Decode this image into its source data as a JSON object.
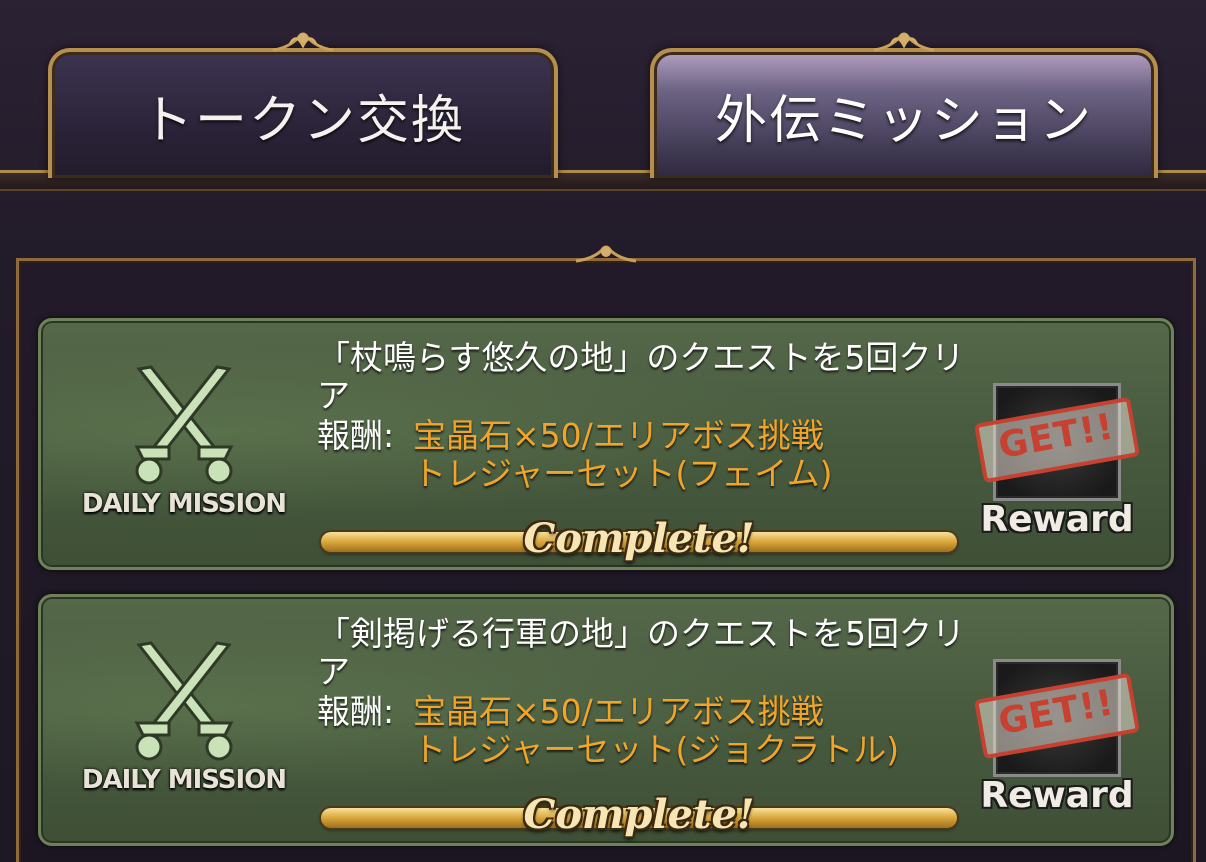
{
  "tabs": [
    {
      "label": "トークン交換",
      "active": false
    },
    {
      "label": "外伝ミッション",
      "active": true
    }
  ],
  "missions": [
    {
      "badge": "DAILY MISSION",
      "badge_icon": "crossed-swords-icon",
      "title": "「杖鳴らす悠久の地」のクエストを5回クリア",
      "reward_label": "報酬:",
      "reward_line_1": "宝晶石×50/エリアボス挑戦",
      "reward_line_2": "トレジャーセット(フェイム)",
      "progress": 1.0,
      "status": "Complete!",
      "stamp": "GET!!",
      "reward_button": "Reward"
    },
    {
      "badge": "DAILY MISSION",
      "badge_icon": "crossed-swords-icon",
      "title": "「剣掲げる行軍の地」のクエストを5回クリア",
      "reward_label": "報酬:",
      "reward_line_1": "宝晶石×50/エリアボス挑戦",
      "reward_line_2": "トレジャーセット(ジョクラトル)",
      "progress": 1.0,
      "status": "Complete!",
      "stamp": "GET!!",
      "reward_button": "Reward"
    }
  ],
  "colors": {
    "accent_gold": "#b68f4e",
    "reward_text": "#f0a52a",
    "stamp_red": "#c8402f",
    "card_green": "#4a5d40"
  }
}
